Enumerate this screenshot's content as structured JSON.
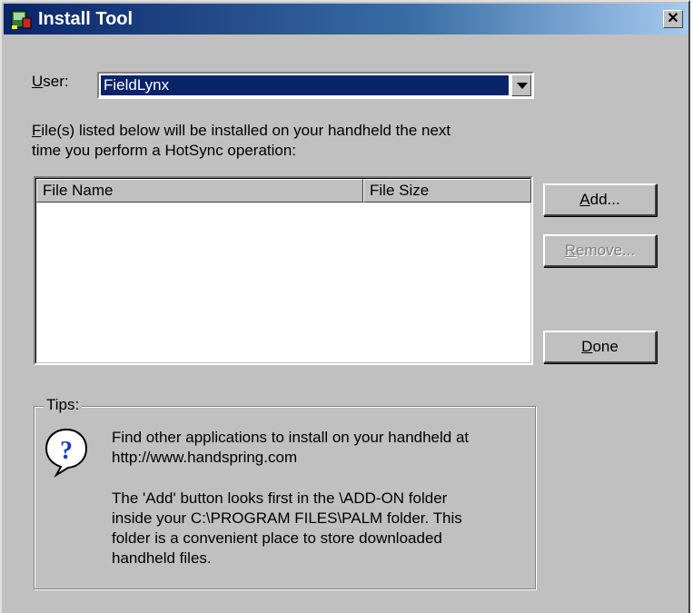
{
  "window": {
    "title": "Install Tool",
    "close_glyph": "✕"
  },
  "user": {
    "label_accel": "U",
    "label_rest": "ser:",
    "selected": "FieldLynx"
  },
  "files": {
    "desc_accel": "F",
    "desc_line1_rest": "ile(s) listed below will be installed on your handheld the next",
    "desc_line2": "time you perform a HotSync operation:",
    "columns": [
      "File Name",
      "File Size"
    ],
    "rows": []
  },
  "buttons": {
    "add": {
      "accel": "A",
      "rest": "dd...",
      "enabled": true
    },
    "remove": {
      "accel": "R",
      "rest": "emove...",
      "enabled": false
    },
    "done": {
      "accel": "D",
      "rest": "one",
      "enabled": true
    }
  },
  "tips": {
    "title": "Tips:",
    "para1_line1": "Find other applications to install on your handheld at",
    "para1_line2": "http://www.handspring.com",
    "para2_line1": "The 'Add' button looks first in the \\ADD-ON folder",
    "para2_line2": "inside your C:\\PROGRAM FILES\\PALM folder. This",
    "para2_line3": "folder is a convenient place to store downloaded",
    "para2_line4": "handheld files."
  },
  "icons": {
    "app": "install-tool-icon",
    "help": "question-balloon-icon"
  },
  "colors": {
    "titlebar_start": "#0a246a",
    "titlebar_end": "#a6caf0",
    "selection": "#0a246a",
    "face": "#c0c0c0"
  }
}
